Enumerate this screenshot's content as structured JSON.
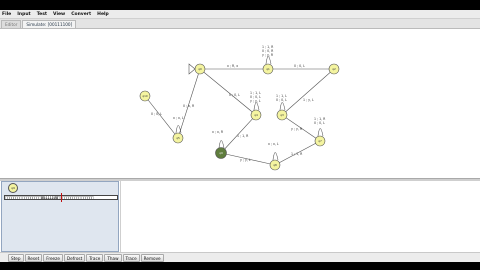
{
  "menu": [
    "File",
    "Input",
    "Test",
    "View",
    "Convert",
    "Help"
  ],
  "tabs": [
    {
      "label": "Editor",
      "active": false
    },
    {
      "label": "Simulate: [00111100]",
      "active": true
    }
  ],
  "colors": {
    "state_fill": "#f4f4a0",
    "current_state_fill": "#5f7d3d",
    "tape_caret": "#c01010"
  },
  "states": [
    {
      "id": "q0",
      "label": "q0"
    },
    {
      "id": "q1",
      "label": "q1"
    },
    {
      "id": "q2",
      "label": "q2"
    },
    {
      "id": "q3",
      "label": "q3"
    },
    {
      "id": "q4",
      "label": "q4"
    },
    {
      "id": "q5",
      "label": "q5"
    },
    {
      "id": "q6",
      "label": "q6"
    },
    {
      "id": "q7",
      "label": "q7"
    },
    {
      "id": "q8",
      "label": "q8"
    },
    {
      "id": "q9",
      "label": "q9"
    },
    {
      "id": "q10",
      "label": "q10"
    }
  ],
  "transitions": {
    "q0_q1": "x ; R, x",
    "q1_q2": "0 ; 0, L",
    "q1_loop": [
      "1 ; 1, R",
      "0 ; 0, R",
      "y ; y, R"
    ],
    "q2_q3": "1 ; y, L",
    "q3_loop": [
      "1 ; 1, L",
      "0 ; 0, L"
    ],
    "q3_q0": "y ; y, R",
    "q6_q4": "0 ; 0, L",
    "q4_q9": "x ; x, L",
    "q5_q0": "0 ; x, R",
    "q9_loop": "x ; x, R",
    "q9_q8": "0 ; 0, L",
    "q8_q7": "1 ; 1, R",
    "q7_loop": [
      "1 ; 1, R",
      "0 ; 0, L"
    ],
    "q7_q6": "y ; y, L",
    "q4_loop": [
      "1 ; 1, L",
      "0 ; 0, L",
      "y ; y, L"
    ]
  },
  "simulation": {
    "current_state": "q9",
    "tape": "□□□□□□□□□□□□□□□□□00111100□□□□□□□□□□□□□□□□□"
  },
  "controls": [
    "Step",
    "Reset",
    "Freeze",
    "Defrost",
    "Trace",
    "Thaw",
    "Trace",
    "Remove"
  ]
}
